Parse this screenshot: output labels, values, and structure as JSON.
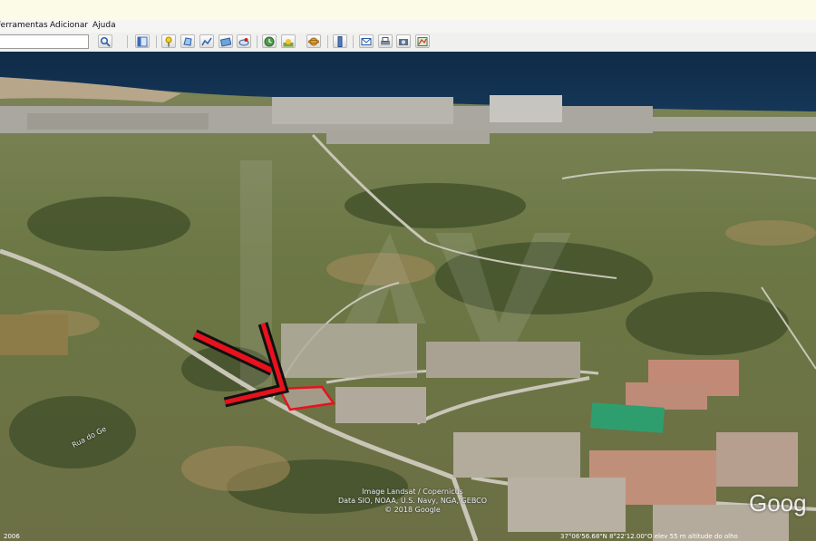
{
  "menu": {
    "items": [
      {
        "label": "Ferramentas"
      },
      {
        "label": "Adicionar"
      },
      {
        "label": "Ajuda"
      }
    ]
  },
  "toolbar": {
    "search_value": "",
    "tools": [
      {
        "name": "search-button",
        "icon": "magnifier-icon"
      },
      {
        "name": "sidebar-toggle-button",
        "icon": "sidebar-icon"
      },
      {
        "name": "add-placemark-button",
        "icon": "pushpin-icon"
      },
      {
        "name": "add-polygon-button",
        "icon": "polygon-icon"
      },
      {
        "name": "add-path-button",
        "icon": "path-icon"
      },
      {
        "name": "add-image-overlay-button",
        "icon": "overlay-icon"
      },
      {
        "name": "record-tour-button",
        "icon": "tour-icon"
      },
      {
        "name": "historical-imagery-button",
        "icon": "clock-icon"
      },
      {
        "name": "sunlight-button",
        "icon": "sun-icon"
      },
      {
        "name": "switch-sky-button",
        "icon": "planet-icon"
      },
      {
        "name": "ruler-button",
        "icon": "ruler-icon"
      },
      {
        "name": "email-button",
        "icon": "envelope-icon"
      },
      {
        "name": "print-button",
        "icon": "printer-icon"
      },
      {
        "name": "save-image-button",
        "icon": "camera-icon"
      },
      {
        "name": "view-in-maps-button",
        "icon": "map-icon"
      }
    ]
  },
  "map": {
    "road_label": "Rua do Ge",
    "attribution": [
      "Image Landsat / Copernicus",
      "Data SIO, NOAA, U.S. Navy, NGA, GEBCO",
      "© 2018 Google"
    ],
    "logo": "Goog",
    "year": "2006",
    "status": "37°06'56.68\"N   8°22'12.00\"O   elev   55 m   altitude do olho",
    "arrow_color": "#e8121c"
  }
}
